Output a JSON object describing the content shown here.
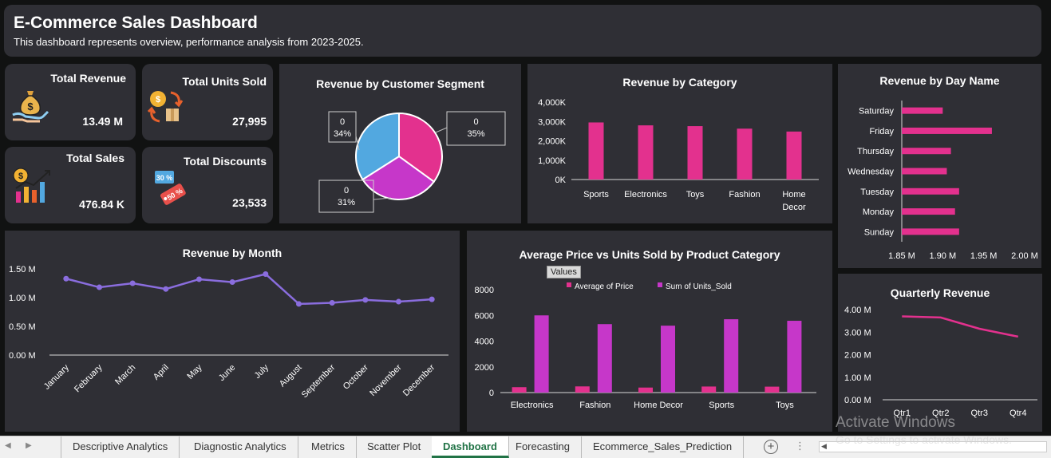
{
  "header": {
    "title": "E-Commerce Sales Dashboard",
    "subtitle": "This dashboard represents overview, performance analysis from 2023-2025."
  },
  "kpis": {
    "revenue": {
      "label": "Total Revenue",
      "value": "13.49 M",
      "icon": "money-bag-icon"
    },
    "units": {
      "label": "Total Units Sold",
      "value": "27,995",
      "icon": "coin-exchange-icon"
    },
    "sales": {
      "label": "Total Sales",
      "value": "476.84 K",
      "icon": "sales-growth-icon"
    },
    "discounts": {
      "label": "Total Discounts",
      "value": "23,533",
      "icon": "discount-tag-icon"
    }
  },
  "colors": {
    "pink": "#e3318e",
    "magenta": "#c637c9",
    "blue": "#52a8e0",
    "purple": "#8a6dde",
    "panel": "#2f2f35"
  },
  "chart_data": [
    {
      "id": "segment",
      "type": "pie",
      "title": "Revenue by Customer Segment",
      "slices": [
        {
          "value": 35,
          "color": "#e3318e",
          "label_top": "0",
          "label_bottom": "35%"
        },
        {
          "value": 31,
          "color": "#c637c9",
          "label_top": "0",
          "label_bottom": "31%"
        },
        {
          "value": 34,
          "color": "#52a8e0",
          "label_top": "0",
          "label_bottom": "34%"
        }
      ]
    },
    {
      "id": "category",
      "type": "bar",
      "title": "Revenue by Category",
      "categories": [
        "Sports",
        "Electronics",
        "Toys",
        "Fashion",
        "Home Decor"
      ],
      "values": [
        2950,
        2800,
        2760,
        2630,
        2480
      ],
      "ylim": [
        0,
        4000
      ],
      "yticks": [
        "4,000K",
        "3,000K",
        "2,000K",
        "1,000K",
        "0K"
      ]
    },
    {
      "id": "dayname",
      "type": "bar",
      "orientation": "horizontal",
      "title": "Revenue by Day Name",
      "categories": [
        "Saturday",
        "Friday",
        "Thursday",
        "Wednesday",
        "Tuesday",
        "Monday",
        "Sunday"
      ],
      "values": [
        1.9,
        1.96,
        1.91,
        1.905,
        1.92,
        1.915,
        1.92
      ],
      "xlim": [
        1.85,
        2.0
      ],
      "xticks": [
        "1.85 M",
        "1.90 M",
        "1.95 M",
        "2.00 M"
      ]
    },
    {
      "id": "month",
      "type": "line",
      "title": "Revenue by Month",
      "categories": [
        "January",
        "February",
        "March",
        "April",
        "May",
        "June",
        "July",
        "August",
        "September",
        "October",
        "November",
        "December"
      ],
      "values": [
        1.33,
        1.18,
        1.25,
        1.15,
        1.32,
        1.27,
        1.41,
        0.89,
        0.91,
        0.96,
        0.93,
        0.97
      ],
      "ylim": [
        0,
        1.5
      ],
      "yticks": [
        "1.50 M",
        "1.00 M",
        "0.50 M",
        "0.00 M"
      ]
    },
    {
      "id": "avgprice",
      "type": "bar",
      "title": "Average Price vs Units Sold by Product Category",
      "button": "Values",
      "categories": [
        "Electronics",
        "Fashion",
        "Home Decor",
        "Sports",
        "Toys"
      ],
      "series": [
        {
          "name": "Average of Price",
          "values": [
            420,
            480,
            390,
            470,
            460
          ],
          "color": "#e3318e"
        },
        {
          "name": "Sum of Units_Sold",
          "values": [
            6000,
            5320,
            5200,
            5700,
            5580
          ],
          "color": "#c637c9"
        }
      ],
      "ylim": [
        0,
        8000
      ],
      "yticks": [
        "8000",
        "6000",
        "4000",
        "2000",
        "0"
      ]
    },
    {
      "id": "quarter",
      "type": "line",
      "title": "Quarterly Revenue",
      "categories": [
        "Qtr1",
        "Qtr2",
        "Qtr3",
        "Qtr4"
      ],
      "values": [
        3.7,
        3.65,
        3.15,
        2.8
      ],
      "ylim": [
        0,
        4
      ],
      "yticks": [
        "4.00 M",
        "3.00 M",
        "2.00 M",
        "1.00 M",
        "0.00 M"
      ]
    }
  ],
  "tabs": [
    {
      "label": "Descriptive Analytics",
      "active": false
    },
    {
      "label": "Diagnostic Analytics",
      "active": false
    },
    {
      "label": "Metrics",
      "active": false
    },
    {
      "label": "Scatter Plot",
      "active": false
    },
    {
      "label": "Dashboard",
      "active": true
    },
    {
      "label": "Forecasting",
      "active": false
    },
    {
      "label": "Ecommerce_Sales_Prediction",
      "active": false
    }
  ],
  "watermark": {
    "line1": "Activate Windows",
    "line2": "Go to Settings to activate Windows."
  }
}
